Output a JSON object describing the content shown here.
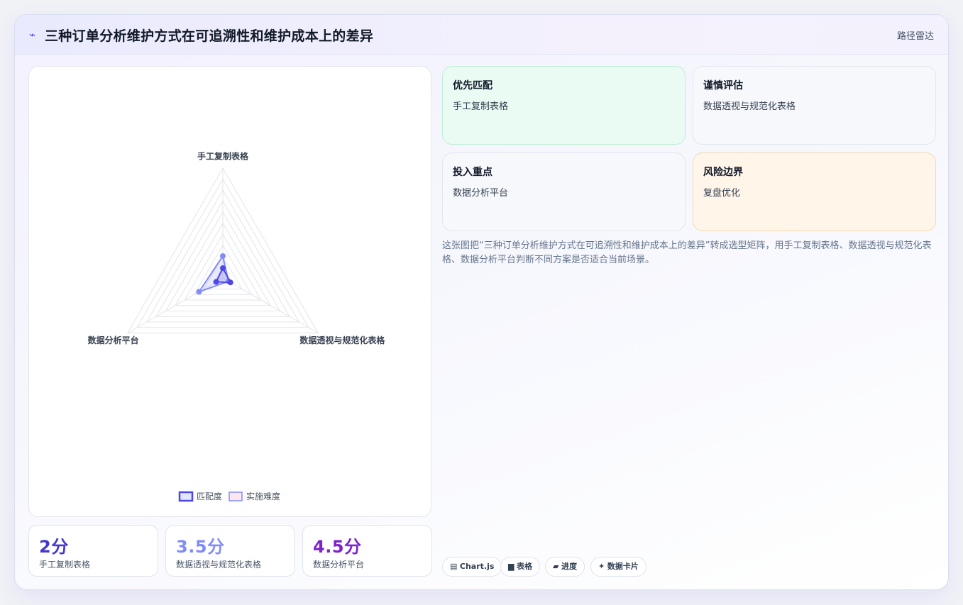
{
  "header": {
    "icon": "chart-line-icon",
    "title": "三种订单分析维护方式在可追溯性和维护成本上的差异",
    "subtitle": "路径雷达"
  },
  "chart_data": {
    "type": "radar",
    "axes": [
      "手工复制表格",
      "数据透视与规范化表格",
      "数据分析平台"
    ],
    "range": [
      0,
      10
    ],
    "gridlines": 10,
    "series": [
      {
        "name": "匹配度",
        "values": [
          0.9,
          0.8,
          0.7
        ],
        "color": "#4f46e5"
      },
      {
        "name": "实施难度",
        "values": [
          2.0,
          0.6,
          2.5
        ],
        "color": "#818cf8"
      }
    ],
    "legend_position": "bottom"
  },
  "kpis": [
    {
      "value": "2分",
      "label": "手工复制表格",
      "color": "#4338ca"
    },
    {
      "value": "3.5分",
      "label": "数据透视与规范化表格",
      "color": "#818cf8"
    },
    {
      "value": "4.5分",
      "label": "数据分析平台",
      "color": "#7e22ce"
    }
  ],
  "cards": [
    {
      "title": "优先匹配",
      "text": "手工复制表格"
    },
    {
      "title": "谨慎评估",
      "text": "数据透视与规范化表格"
    },
    {
      "title": "投入重点",
      "text": "数据分析平台"
    },
    {
      "title": "风险边界",
      "text": "复盘优化"
    }
  ],
  "description": "这张图把“三种订单分析维护方式在可追溯性和维护成本上的差异”转成选型矩阵，用手工复制表格、数据透视与规范化表格、数据分析平台判断不同方案是否适合当前场景。",
  "tags": [
    {
      "icon": "chart-icon",
      "glyph": "▤",
      "label": "Chart.js"
    },
    {
      "icon": "table-icon",
      "glyph": "▆",
      "label": "表格"
    },
    {
      "icon": "progress-icon",
      "glyph": "▰",
      "label": "进度"
    },
    {
      "icon": "sparkle-icon",
      "glyph": "✦",
      "label": "数据卡片"
    }
  ]
}
